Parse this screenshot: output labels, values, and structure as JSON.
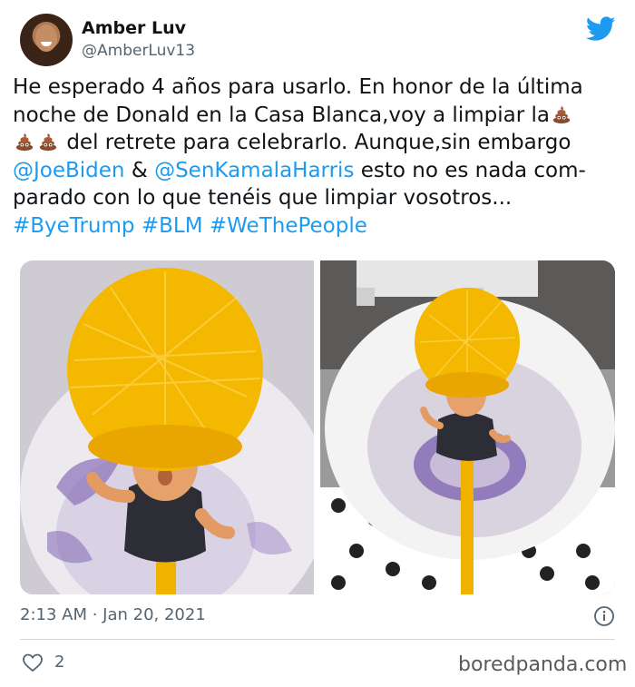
{
  "tweet": {
    "author": {
      "display_name": "Amber Luv",
      "handle": "@AmberLuv13"
    },
    "text": {
      "line1": "He esperado 4 años para usarlo. En honor de la última",
      "line2": "noche de Donald en la Casa Blanca,voy a limpiar la",
      "line3": "del retrete para celebrarlo. Aunque,sin embargo",
      "line4_mention1": "@JoeBiden",
      "line4_amp": " & ",
      "line4_mention2": "@SenKamalaHarris",
      "line4_rest": " esto no es nada com-",
      "line5": "parado con lo que tenéis que limpiar vosotros...",
      "hashtags": [
        "#ByeTrump",
        "#BLM",
        "#WeThePeople"
      ]
    },
    "emoji_icon": "pile-of-poo-emoji",
    "timestamp": "2:13 AM · Jan 20, 2021",
    "like_count": "2"
  },
  "watermark": "boredpanda.com",
  "colors": {
    "link": "#1d9bf0",
    "twitter_blue": "#1d9bf0",
    "secondary_text": "#536471",
    "brush_yellow": "#f5b800"
  }
}
